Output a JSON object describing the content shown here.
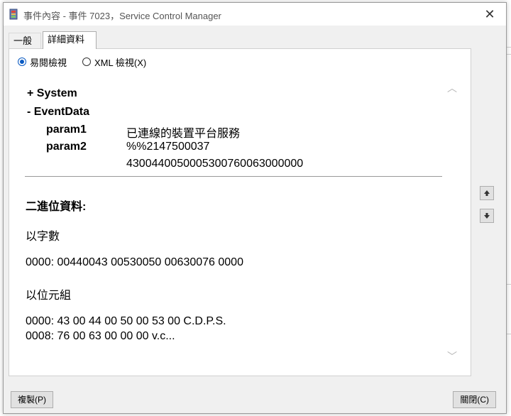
{
  "window": {
    "title": "事件內容 - 事件 7023，Service Control Manager",
    "close_glyph": "✕"
  },
  "tabs": [
    {
      "label": "一般",
      "active": false
    },
    {
      "label": "詳細資料",
      "active": true
    }
  ],
  "view_mode": {
    "options": [
      {
        "label": "易閱檢視",
        "checked": true
      },
      {
        "label": "XML 檢視(X)",
        "checked": false
      }
    ]
  },
  "details": {
    "system_node": "+ System",
    "eventdata_node": "-  EventData",
    "params": [
      {
        "name": "param1",
        "value": "已連線的裝置平台服務"
      },
      {
        "name": "param2",
        "value": "%%2147500037"
      }
    ],
    "param2_cont": "4300440050005300760063000000",
    "binary_title": "二進位資料:",
    "words_label": "以字數",
    "words_line": "0000: 00440043 00530050 00630076 0000",
    "bytes_label": "以位元組",
    "bytes_lines": [
      "0000: 43 00 44 00 50 00 53 00   C.D.P.S.",
      "0008: 76 00 63 00 00 00        v.c..."
    ]
  },
  "side_buttons": {
    "up_icon": "up-arrow-icon",
    "down_icon": "down-arrow-icon"
  },
  "buttons": {
    "copy": "複製(P)",
    "close": "關閉(C)"
  },
  "colors": {
    "accent": "#0a5ac2",
    "panel": "#f0f0f0"
  }
}
